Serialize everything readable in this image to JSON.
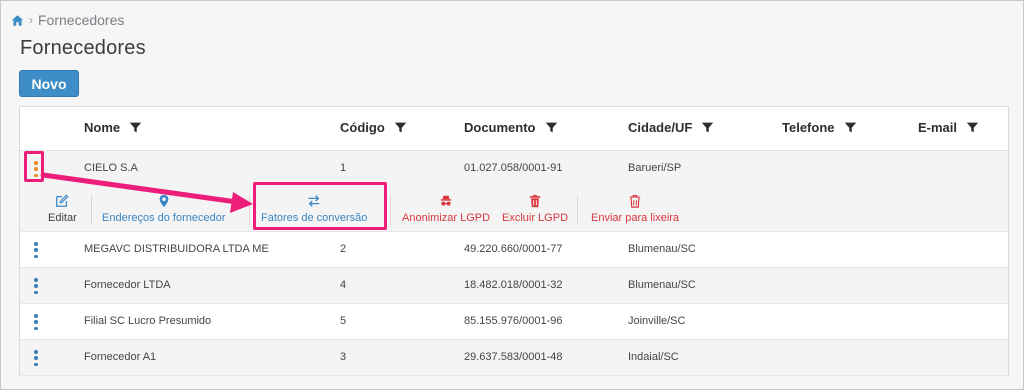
{
  "breadcrumb": {
    "home_icon": "home-icon",
    "current": "Fornecedores"
  },
  "page": {
    "title": "Fornecedores"
  },
  "toolbar": {
    "new_label": "Novo"
  },
  "table": {
    "columns": [
      {
        "label": "Nome",
        "filter_icon": "filter-icon"
      },
      {
        "label": "Código",
        "filter_icon": "filter-icon"
      },
      {
        "label": "Documento",
        "filter_icon": "filter-icon"
      },
      {
        "label": "Cidade/UF",
        "filter_icon": "filter-icon"
      },
      {
        "label": "Telefone",
        "filter_icon": "filter-icon"
      },
      {
        "label": "E-mail",
        "filter_icon": "filter-icon"
      }
    ],
    "rows": [
      {
        "nome": "CIELO S.A",
        "codigo": "1",
        "documento": "01.027.058/0001-91",
        "cidade": "Barueri/SP",
        "telefone": "",
        "email": ""
      },
      {
        "nome": "MEGAVC DISTRIBUIDORA LTDA ME",
        "codigo": "2",
        "documento": "49.220.660/0001-77",
        "cidade": "Blumenau/SC",
        "telefone": "",
        "email": ""
      },
      {
        "nome": "Fornecedor LTDA",
        "codigo": "4",
        "documento": "18.482.018/0001-32",
        "cidade": "Blumenau/SC",
        "telefone": "",
        "email": ""
      },
      {
        "nome": "Filial SC Lucro Presumido",
        "codigo": "5",
        "documento": "85.155.976/0001-96",
        "cidade": "Joinville/SC",
        "telefone": "",
        "email": ""
      },
      {
        "nome": "Fornecedor A1",
        "codigo": "3",
        "documento": "29.637.583/0001-48",
        "cidade": "Indaial/SC",
        "telefone": "",
        "email": ""
      }
    ],
    "row_actions": [
      {
        "label": "Editar",
        "icon": "edit-icon"
      },
      {
        "label": "Endereços do fornecedor",
        "icon": "map-pin-icon"
      },
      {
        "label": "Fatores de conversão",
        "icon": "swap-arrows-icon"
      },
      {
        "label": "Anonimizar LGPD",
        "icon": "incognito-icon"
      },
      {
        "label": "Excluir LGPD",
        "icon": "trash-icon"
      },
      {
        "label": "Enviar para lixeira",
        "icon": "trash-outline-icon"
      }
    ]
  },
  "colors": {
    "primary": "#3f8dc6",
    "link": "#3a86c4",
    "danger": "#d9363e",
    "highlight": "#ec1e79",
    "kebab_active": "#f08a24"
  }
}
